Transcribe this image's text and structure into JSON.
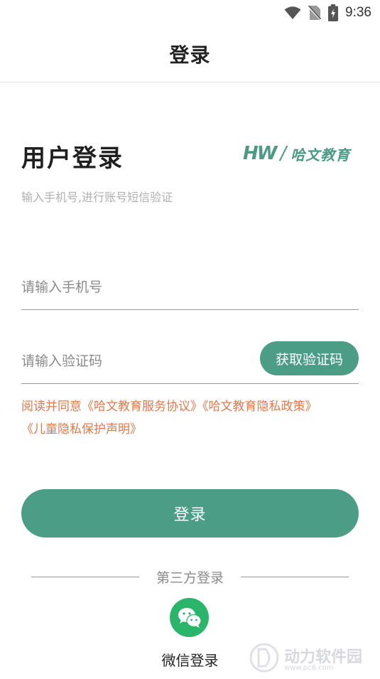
{
  "status_bar": {
    "time": "9:36",
    "icons": [
      "wifi-icon",
      "no-sim-icon",
      "battery-charging-icon"
    ]
  },
  "header": {
    "title": "登录"
  },
  "login_form": {
    "heading": "用户登录",
    "brand": {
      "mark": "HW",
      "name": "哈文教育",
      "color": "#4a9a84"
    },
    "subtitle": "输入手机号,进行账号短信验证",
    "phone_input": {
      "value": "",
      "placeholder": "请输入手机号"
    },
    "code_input": {
      "value": "",
      "placeholder": "请输入验证码"
    },
    "get_code_label": "获取验证码",
    "agreement": {
      "prefix": "阅读并同意",
      "service_agreement": "《哈文教育服务协议》",
      "privacy_policy": "《哈文教育隐私政策》",
      "children_privacy": "《儿童隐私保护声明》",
      "color": "#e0784a"
    },
    "login_label": "登录",
    "accent_color": "#4b9d86"
  },
  "third_party": {
    "divider_label": "第三方登录",
    "wechat_label": "微信登录",
    "wechat_color": "#2ab56b"
  },
  "watermark": {
    "text": "动力软件园",
    "url": "www.pc6.com"
  }
}
